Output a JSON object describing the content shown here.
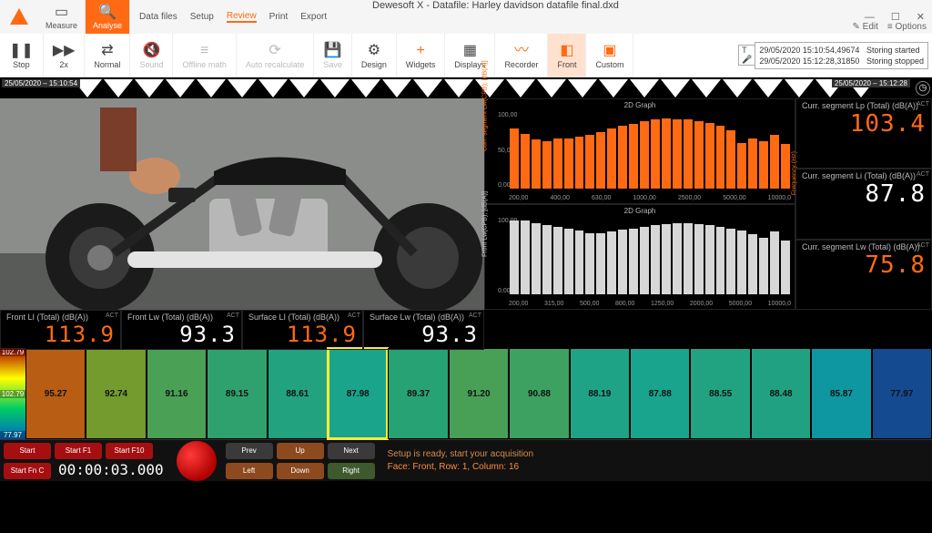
{
  "title": "Dewesoft X - Datafile: Harley davidson datafile final.dxd",
  "top": {
    "measure": "Measure",
    "analyse": "Analyse"
  },
  "menu": [
    "Data files",
    "Setup",
    "Review",
    "Print",
    "Export"
  ],
  "menu_active_index": 2,
  "rightopts": {
    "edit": "Edit",
    "options": "Options"
  },
  "ribbon": {
    "stop": "Stop",
    "x2": "2x",
    "normal": "Normal",
    "sound": "Sound",
    "offline": "Offline math",
    "autorec": "Auto recalculate",
    "save": "Save",
    "design": "Design",
    "widgets": "Widgets",
    "displays": "Displays",
    "recorder": "Recorder",
    "front": "Front",
    "custom": "Custom"
  },
  "log": {
    "l1_ts": "29/05/2020 15:10:54,49674",
    "l1_ev": "Storing started",
    "l2_ts": "29/05/2020 15:12:28,31850",
    "l2_ev": "Storing stopped"
  },
  "timeline": {
    "left_label": "25/05/2020 – 15:10:54",
    "right_label": "25/05/2020 – 15:12:28"
  },
  "chart_data": [
    {
      "type": "bar",
      "title": "2D Graph",
      "ylabel": "Curr. segment Lw(CPB); [dB(A)]",
      "ylabel_right": "Frequency (Hz)",
      "ylim": [
        0,
        100
      ],
      "yticks": [
        "100,00",
        "50,00",
        "0,00"
      ],
      "categories": [
        "200,00",
        "400,00",
        "630,00",
        "1000,00",
        "2500,00",
        "5000,00",
        "10000,0"
      ],
      "values": [
        78,
        72,
        64,
        62,
        65,
        66,
        68,
        70,
        74,
        78,
        82,
        85,
        88,
        90,
        92,
        91,
        90,
        88,
        86,
        82,
        76,
        60,
        65,
        62,
        70,
        58
      ],
      "color": "#ff6a13"
    },
    {
      "type": "bar",
      "title": "2D Graph",
      "ylabel": "Front Lw(CPB); [dB(A)]",
      "ylim": [
        0,
        100
      ],
      "yticks": [
        "100,00",
        "",
        "0,00"
      ],
      "categories": [
        "200,00",
        "315,00",
        "500,00",
        "800,00",
        "1250,00",
        "2000,00",
        "5000,00",
        "10000,0"
      ],
      "values": [
        96,
        97,
        93,
        90,
        88,
        86,
        83,
        80,
        80,
        82,
        84,
        86,
        88,
        90,
        92,
        93,
        93,
        92,
        90,
        88,
        86,
        83,
        79,
        74,
        82,
        70
      ],
      "color": "#d7d7d7"
    }
  ],
  "digitals_right": [
    {
      "caption": "Curr. segment Lp (Total) (dB(A))",
      "value": "103.4"
    },
    {
      "caption": "Curr. segment Li (Total) (dB(A))",
      "value": "87.8",
      "white": true
    },
    {
      "caption": "Curr. segment Lw (Total) (dB(A))",
      "value": "75.8"
    }
  ],
  "digitals_bottom": [
    {
      "caption": "Front LI (Total) (dB(A))",
      "value": "113.9"
    },
    {
      "caption": "Front Lw (Total) (dB(A))",
      "value": "93.3",
      "white": true
    },
    {
      "caption": "Surface LI (Total) (dB(A))",
      "value": "113.9"
    },
    {
      "caption": "Surface Lw (Total) (dB(A))",
      "value": "93.3",
      "white": true
    }
  ],
  "act_label": "ACT",
  "color_table": {
    "scale": [
      "102.79",
      "102.79",
      "77.97"
    ],
    "cells": [
      {
        "v": "95.27",
        "c": "#b85d14"
      },
      {
        "v": "92.74",
        "c": "#739b2e"
      },
      {
        "v": "91.16",
        "c": "#4aa055"
      },
      {
        "v": "89.15",
        "c": "#2fa16e"
      },
      {
        "v": "88.61",
        "c": "#22a27e"
      },
      {
        "v": "87.98",
        "c": "#1aa48c",
        "sel": true
      },
      {
        "v": "89.37",
        "c": "#27a275"
      },
      {
        "v": "91.20",
        "c": "#48a057"
      },
      {
        "v": "90.88",
        "c": "#3da162"
      },
      {
        "v": "88.19",
        "c": "#1ea386"
      },
      {
        "v": "87.88",
        "c": "#19a48d"
      },
      {
        "v": "88.55",
        "c": "#21a280"
      },
      {
        "v": "88.48",
        "c": "#20a282"
      },
      {
        "v": "85.87",
        "c": "#0e97a0"
      },
      {
        "v": "77.97",
        "c": "#144a8f"
      }
    ]
  },
  "ctrl": {
    "btns": {
      "start": "Start",
      "startf1": "Start F1",
      "startf10": "Start F10",
      "startfnc": "Start Fn C",
      "prev": "Prev",
      "up": "Up",
      "next": "Next",
      "left": "Left",
      "down": "Down",
      "right": "Right"
    },
    "timecode": "00:00:03.000",
    "status1": "Setup is ready, start your acquisition",
    "status2": "Face: Front, Row: 1, Column: 16"
  }
}
